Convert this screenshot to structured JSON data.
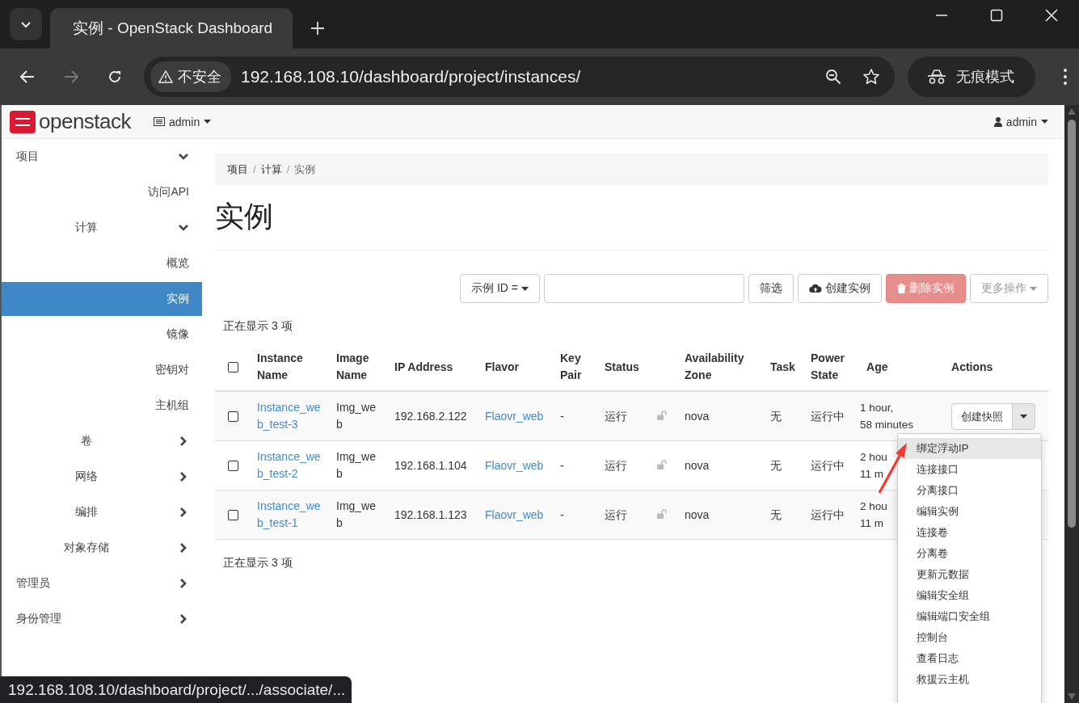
{
  "browser": {
    "tab_title": "实例 - OpenStack Dashboard",
    "security_label": "不安全",
    "url": "192.168.108.10/dashboard/project/instances/",
    "incognito_label": "无痕模式"
  },
  "topbar": {
    "logo_text": "openstack",
    "project_menu": "admin",
    "user_menu": "admin"
  },
  "sidebar": {
    "items": [
      {
        "label": "项目",
        "expanded": true,
        "selected": false,
        "children": [
          {
            "label": "访问API",
            "selected": false
          },
          {
            "label": "计算",
            "expanded": true,
            "selected": false,
            "children": [
              {
                "label": "概览",
                "selected": false
              },
              {
                "label": "实例",
                "selected": true
              },
              {
                "label": "镜像",
                "selected": false
              },
              {
                "label": "密钥对",
                "selected": false
              },
              {
                "label": "主机组",
                "selected": false
              }
            ]
          },
          {
            "label": "卷",
            "expanded": false,
            "selected": false
          },
          {
            "label": "网络",
            "expanded": false,
            "selected": false
          },
          {
            "label": "编排",
            "expanded": false,
            "selected": false
          },
          {
            "label": "对象存储",
            "expanded": false,
            "selected": false
          }
        ]
      },
      {
        "label": "管理员",
        "expanded": false,
        "selected": false
      },
      {
        "label": "身份管理",
        "expanded": false,
        "selected": false
      }
    ]
  },
  "breadcrumb": [
    "项目",
    "计算",
    "实例"
  ],
  "breadcrumb_separator": "/",
  "page_title": "实例",
  "toolbar": {
    "filter_select": "示例 ID =",
    "buttons": [
      {
        "kind": "filter",
        "label": "筛选"
      },
      {
        "kind": "create",
        "label": "创建实例"
      },
      {
        "kind": "delete",
        "label": "删除实例",
        "disabled": true
      },
      {
        "kind": "more",
        "label": "更多操作",
        "disabled": true
      }
    ]
  },
  "count_top": "正在显示 3 项",
  "table": {
    "columns": [
      "Instance Name",
      "Image Name",
      "IP Address",
      "Flavor",
      "Key Pair",
      "Status",
      "Availability Zone",
      "Task",
      "Power State",
      "Age",
      "Actions"
    ],
    "select_all_checked": false,
    "rows": [
      {
        "checked": false,
        "name": "Instance_web_test-3",
        "image": "Img_web",
        "ip": "192.168.2.122",
        "flavor": "Flaovr_web",
        "key_pair": "-",
        "status": "运行",
        "zone": "nova",
        "task": "无",
        "power_state": "运行中",
        "age": [
          "1 hour,",
          "58 minutes"
        ],
        "action": "创建快照"
      },
      {
        "checked": false,
        "name": "Instance_web_test-2",
        "image": "Img_web",
        "ip": "192.168.1.104",
        "flavor": "Flaovr_web",
        "key_pair": "-",
        "status": "运行",
        "zone": "nova",
        "task": "无",
        "power_state": "运行中",
        "age": [
          "2 hou",
          "11 m"
        ]
      },
      {
        "checked": false,
        "name": "Instance_web_test-1",
        "image": "Img_web",
        "ip": "192.168.1.123",
        "flavor": "Flaovr_web",
        "key_pair": "-",
        "status": "运行",
        "zone": "nova",
        "task": "无",
        "power_state": "运行中",
        "age": [
          "2 hou",
          "11 m"
        ]
      }
    ]
  },
  "count_bottom": "正在显示 3 项",
  "action_menu": {
    "items": [
      {
        "label": "绑定浮动IP",
        "selected": true
      },
      {
        "label": "连接接口",
        "selected": false
      },
      {
        "label": "分离接口",
        "selected": false
      },
      {
        "label": "编辑实例",
        "selected": false
      },
      {
        "label": "连接卷",
        "selected": false
      },
      {
        "label": "分离卷",
        "selected": false
      },
      {
        "label": "更新元数据",
        "selected": false
      },
      {
        "label": "编辑安全组",
        "selected": false
      },
      {
        "label": "编辑端口安全组",
        "selected": false
      },
      {
        "label": "控制台",
        "selected": false
      },
      {
        "label": "查看日志",
        "selected": false
      },
      {
        "label": "救援云主机",
        "selected": false
      }
    ]
  },
  "status_url": "192.168.108.10/dashboard/project/.../associate/..."
}
